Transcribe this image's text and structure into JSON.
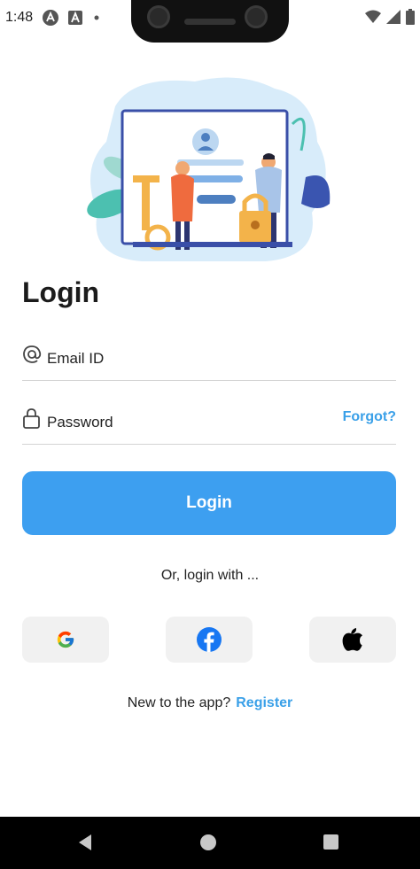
{
  "status_bar": {
    "time": "1:48"
  },
  "screen": {
    "title": "Login",
    "email": {
      "placeholder": "Email ID",
      "value": ""
    },
    "password": {
      "placeholder": "Password",
      "value": ""
    },
    "forgot_label": "Forgot?",
    "login_label": "Login",
    "or_text": "Or, login with ...",
    "social": [
      "google-icon",
      "facebook-icon",
      "apple-icon"
    ],
    "register_prompt": "New to the app?",
    "register_label": "Register"
  },
  "colors": {
    "accent": "#3d9ff0",
    "link": "#3aa0e8",
    "social_bg": "#f1f1f1"
  }
}
